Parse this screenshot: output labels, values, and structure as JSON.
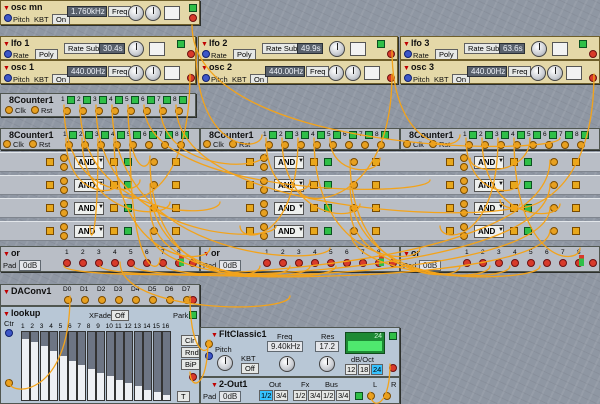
{
  "colors": {
    "wire": "#f3a31a",
    "jack": "#e7a020",
    "green": "#2fbf47",
    "red": "#d83a2a",
    "blue": "#3d57c8"
  },
  "osc_mn": {
    "title": "osc mn",
    "pitch_label": "Pitch",
    "kbt_label": "KBT",
    "on_button": "On",
    "freq_value": "1.760kHz",
    "freq_button": "Freq"
  },
  "lfo1": {
    "title": "lfo 1",
    "rate_label": "Rate",
    "poly_button": "Poly",
    "rate_sub_button": "Rate Sub",
    "rate_value": "30.4s"
  },
  "lfo2": {
    "title": "lfo 2",
    "rate_label": "Rate",
    "poly_button": "Poly",
    "rate_sub_button": "Rate Sub",
    "rate_value": "49.9s"
  },
  "lfo3": {
    "title": "lfo 3",
    "rate_label": "Rate",
    "poly_button": "Poly",
    "rate_sub_button": "Rate Sub",
    "rate_value": "63.6s"
  },
  "osc1": {
    "title": "osc 1",
    "pitch_label": "Pitch",
    "kbt_label": "KBT",
    "on_button": "On",
    "freq_value": "440.00Hz",
    "freq_button": "Freq"
  },
  "osc2": {
    "title": "osc 2",
    "pitch_label": "Pitch",
    "kbt_label": "KBT",
    "on_button": "On",
    "freq_value": "440.00Hz",
    "freq_button": "Freq"
  },
  "osc3": {
    "title": "osc 3",
    "pitch_label": "Pitch",
    "kbt_label": "KBT",
    "on_button": "On",
    "freq_value": "440.00Hz",
    "freq_button": "Freq"
  },
  "counter_top": {
    "title": "8Counter1",
    "clk_label": "Clk",
    "rst_label": "Rst",
    "steps": [
      "1",
      "2",
      "3",
      "4",
      "5",
      "6",
      "7",
      "8"
    ]
  },
  "counters": [
    {
      "title": "8Counter1",
      "clk_label": "Clk",
      "rst_label": "Rst",
      "steps": [
        "1",
        "2",
        "3",
        "4",
        "5",
        "6",
        "7",
        "8"
      ]
    },
    {
      "title": "8Counter1",
      "clk_label": "Clk",
      "rst_label": "Rst",
      "steps": [
        "1",
        "2",
        "3",
        "4",
        "5",
        "6",
        "7",
        "8"
      ]
    },
    {
      "title": "8Counter1",
      "clk_label": "Clk",
      "rst_label": "Rst",
      "steps": [
        "1",
        "2",
        "3",
        "4",
        "5",
        "6",
        "7",
        "8"
      ]
    }
  ],
  "logic_gate": "AND",
  "or_blocks": [
    {
      "title": "or",
      "pad_label": "Pad",
      "pad_value": "0dB",
      "inputs": [
        "1",
        "2",
        "3",
        "4",
        "5",
        "6",
        "7",
        "8"
      ]
    },
    {
      "title": "or",
      "pad_label": "Pad",
      "pad_value": "0dB",
      "inputs": [
        "1",
        "2",
        "3",
        "4",
        "5",
        "6",
        "7",
        "8"
      ]
    },
    {
      "title": "or",
      "pad_label": "Pad",
      "pad_value": "0dB",
      "inputs": [
        "1",
        "2",
        "3",
        "4",
        "5",
        "6",
        "7",
        "8"
      ]
    }
  ],
  "daconv": {
    "title": "DAConv1",
    "bits": [
      "D0",
      "D1",
      "D2",
      "D3",
      "D4",
      "D5",
      "D6",
      "D7"
    ]
  },
  "lookup": {
    "title": "lookup",
    "ctr_label": "Ctr",
    "xfade_label": "XFade",
    "xfade_value": "Off",
    "park_label": "Park",
    "steps": [
      "1",
      "2",
      "3",
      "4",
      "5",
      "6",
      "7",
      "8",
      "9",
      "10",
      "11",
      "12",
      "13",
      "14",
      "15",
      "16"
    ],
    "values": [
      0.9,
      0.85,
      0.8,
      0.72,
      0.65,
      0.58,
      0.52,
      0.45,
      0.4,
      0.35,
      0.3,
      0.25,
      0.2,
      0.15,
      0.12,
      0.08
    ],
    "clr_button": "Clr",
    "rnd_button": "Rnd",
    "bip_button": "BiP",
    "t_button": "T"
  },
  "filter": {
    "title": "FltClassic1",
    "freq_label": "Freq",
    "freq_value": "9.40kHz",
    "res_label": "Res",
    "res_value": "17.2",
    "pitch_label": "Pitch",
    "kbt_label": "KBT",
    "kbt_value": "Off",
    "slope_label": "dB/Oct",
    "slopes": [
      "12",
      "18",
      "24"
    ],
    "slope_selected": "24",
    "display_value": "24"
  },
  "out2": {
    "title": "2-Out1",
    "pad_label": "Pad",
    "pad_value": "0dB",
    "out_label": "Out",
    "fx_label": "Fx",
    "bus_label": "Bus",
    "out_options": [
      "1/2",
      "3/4"
    ],
    "fx_options": [
      "1/2",
      "3/4"
    ],
    "bus_options": [
      "1/2",
      "3/4"
    ],
    "left_label": "L",
    "right_label": "R"
  }
}
